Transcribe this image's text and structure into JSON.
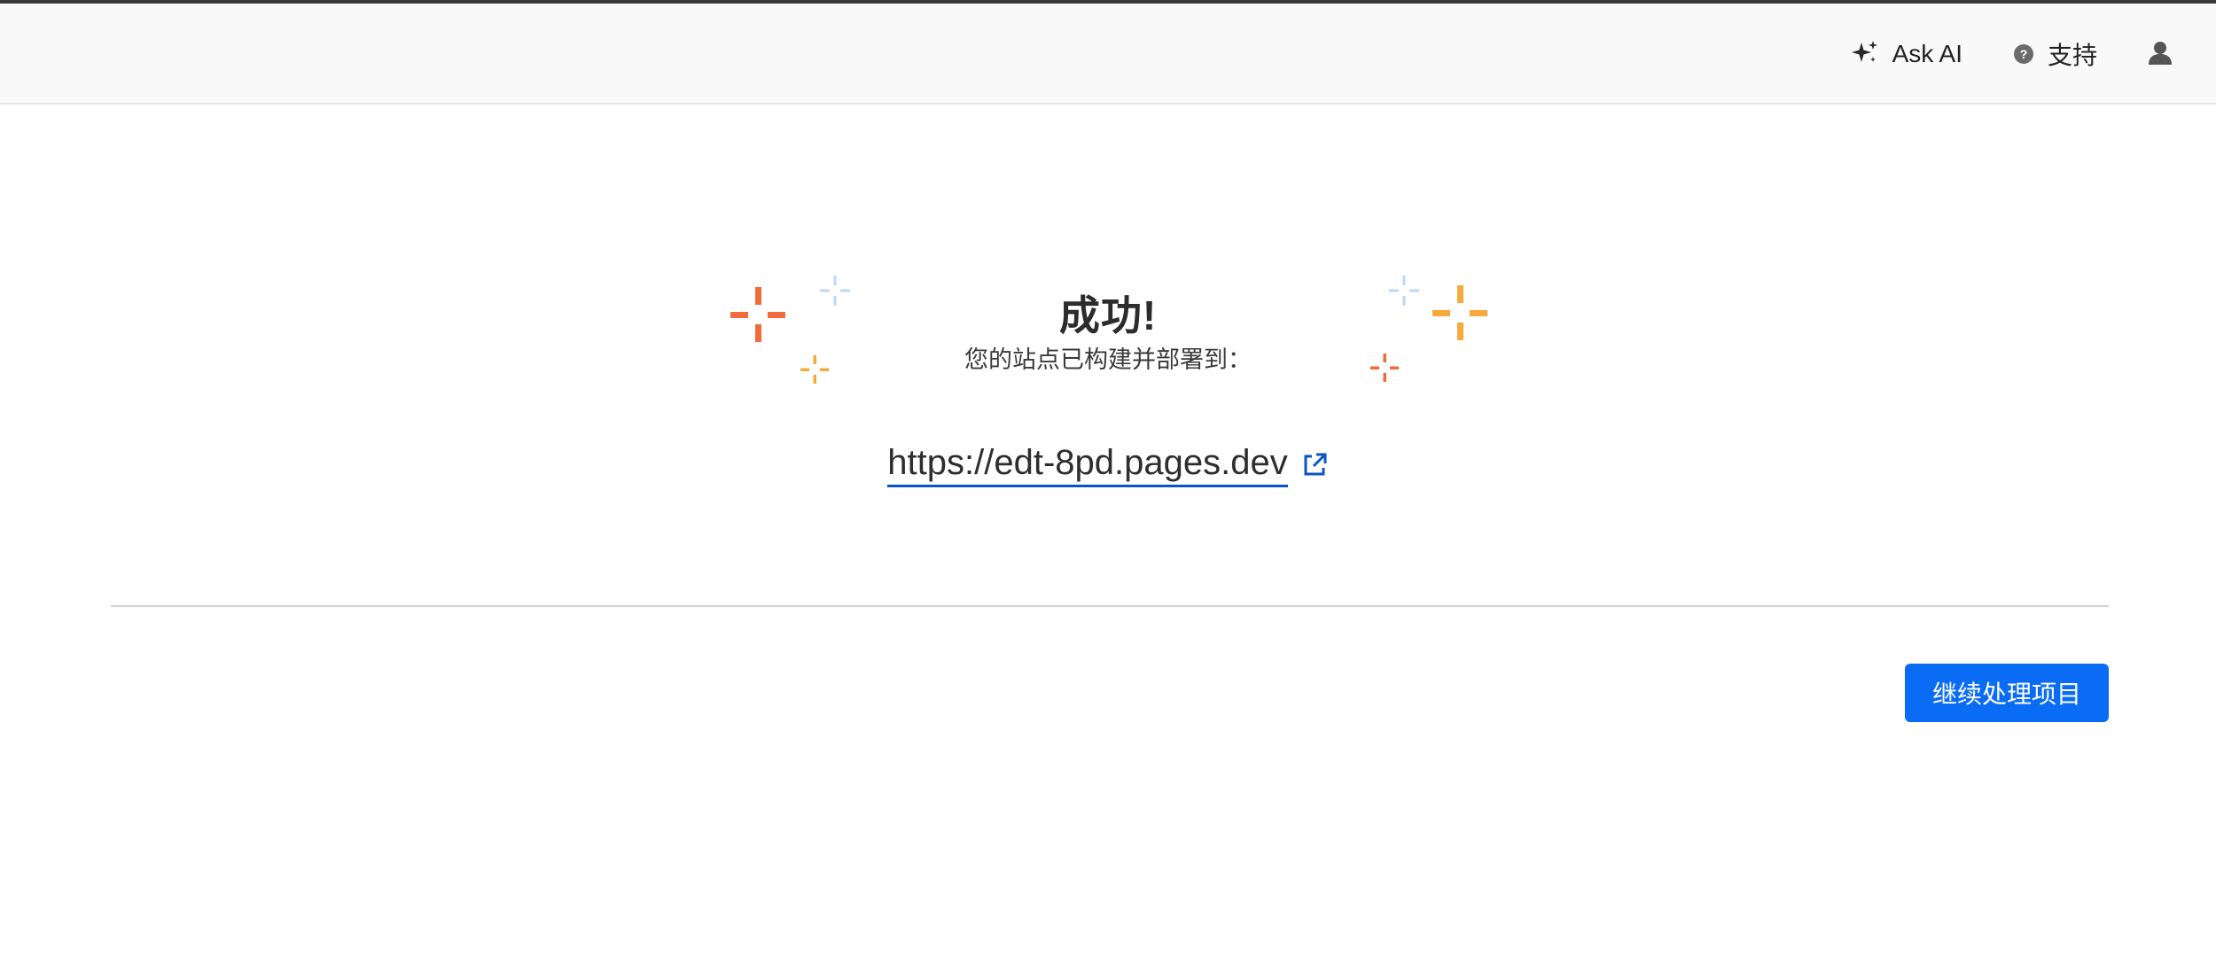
{
  "header": {
    "ask_ai_label": "Ask AI",
    "support_label": "支持"
  },
  "success": {
    "title": "成功!",
    "subtitle": "您的站点已构建并部署到：",
    "site_url": "https://edt-8pd.pages.dev"
  },
  "actions": {
    "continue_label": "继续处理项目"
  },
  "colors": {
    "primary_button": "#0a6cf5",
    "link_underline": "#0a54c5",
    "sparkle_orange": "#f26b3a",
    "sparkle_yellow": "#f7a93b",
    "sparkle_blue": "#bcd8f7"
  },
  "icons": {
    "ask_ai": "sparkles-icon",
    "support": "help-circle-icon",
    "user": "user-icon",
    "external_link": "external-link-icon"
  }
}
